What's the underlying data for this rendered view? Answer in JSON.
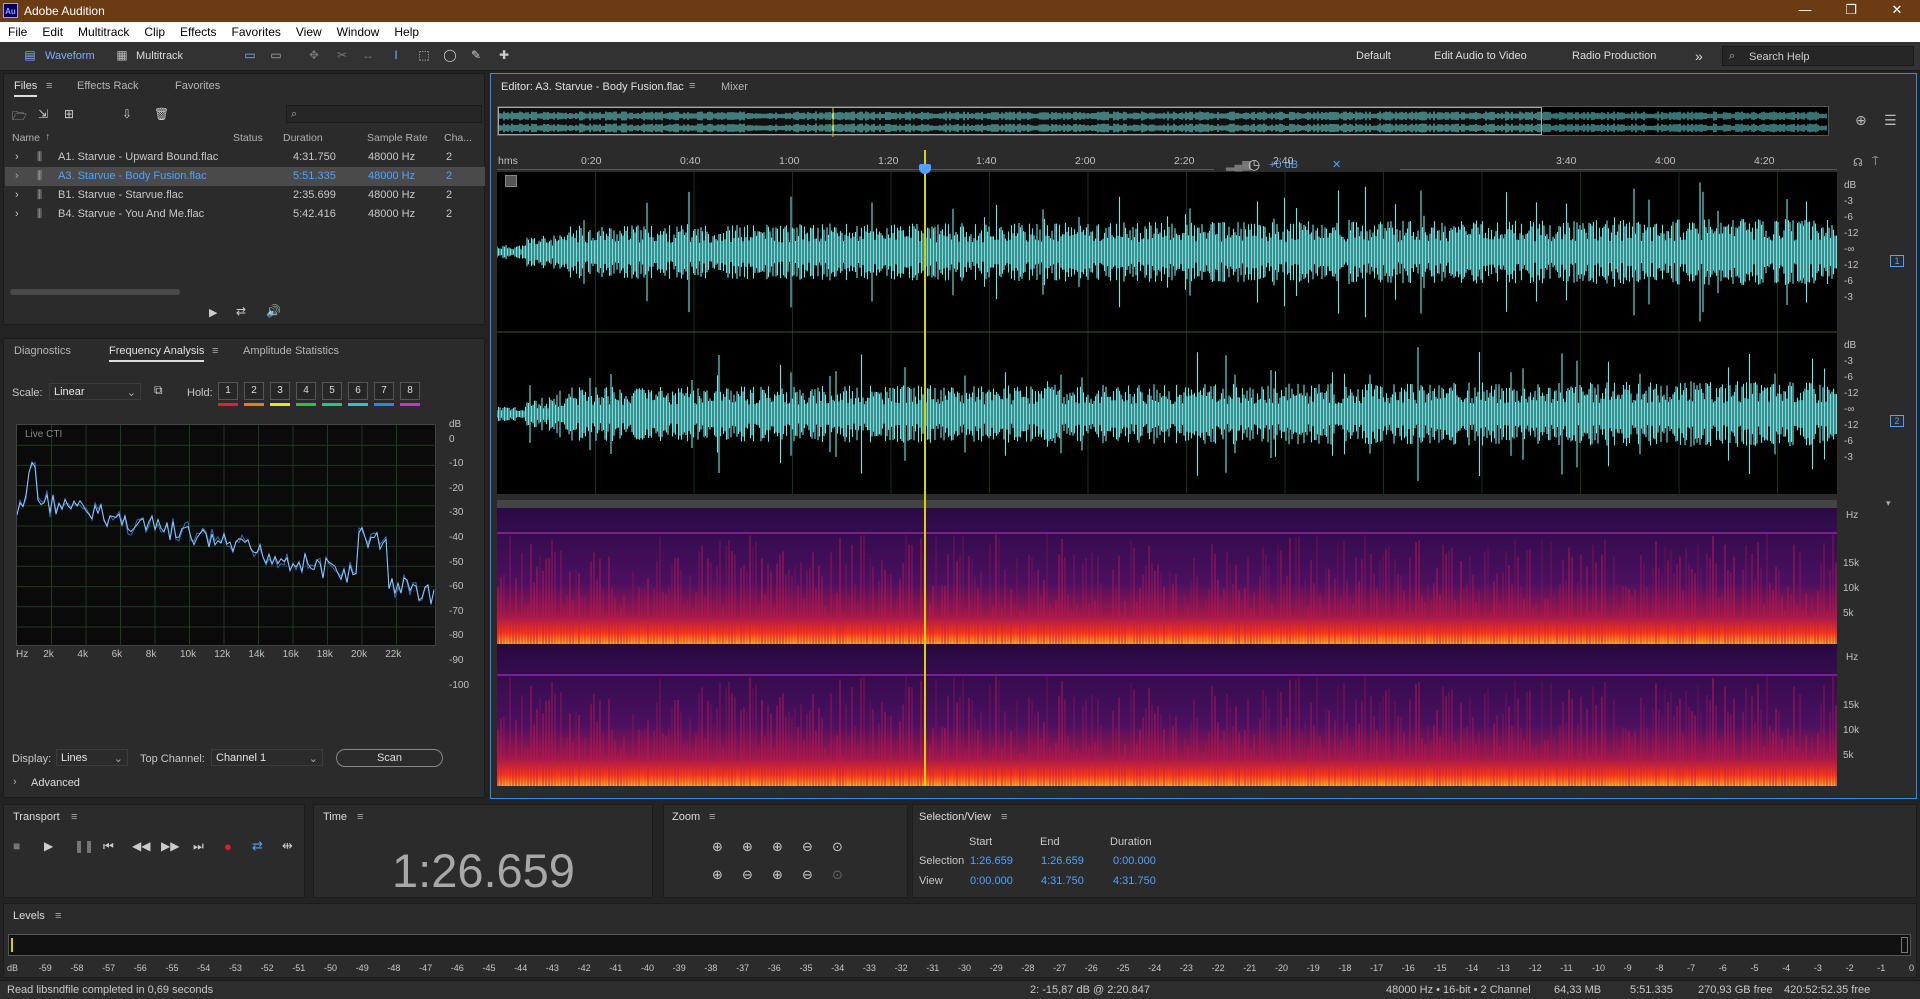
{
  "app": {
    "title": "Adobe Audition",
    "logo": "Au",
    "min_icon": "minimize-icon",
    "max_icon": "maximize-icon",
    "close_icon": "close-icon"
  },
  "menu": [
    "File",
    "Edit",
    "Multitrack",
    "Clip",
    "Effects",
    "Favorites",
    "View",
    "Window",
    "Help"
  ],
  "toolbar": {
    "waveform": "Waveform",
    "multitrack": "Multitrack",
    "workspaces": [
      "Default",
      "Edit Audio to Video",
      "Radio Production"
    ],
    "more": "»",
    "search": "Search Help"
  },
  "files_panel": {
    "tabs": [
      "Files",
      "Effects Rack",
      "Favorites"
    ],
    "search_icon": "⌕",
    "columns": [
      "Name",
      "Status",
      "Duration",
      "Sample Rate",
      "Cha..."
    ],
    "rows": [
      {
        "name": "A1. Starvue - Upward Bound.flac",
        "duration": "4:31.750",
        "rate": "48000 Hz",
        "ch": "2"
      },
      {
        "name": "A3. Starvue - Body Fusion.flac",
        "duration": "5:51.335",
        "rate": "48000 Hz",
        "ch": "2"
      },
      {
        "name": "B1. Starvue - Starvue.flac",
        "duration": "2:35.699",
        "rate": "48000 Hz",
        "ch": "2"
      },
      {
        "name": "B4. Starvue - You And Me.flac",
        "duration": "5:42.416",
        "rate": "48000 Hz",
        "ch": "2"
      }
    ]
  },
  "analysis": {
    "tabs": [
      "Diagnostics",
      "Frequency Analysis",
      "Amplitude Statistics"
    ],
    "scale_label": "Scale:",
    "scale": "Linear",
    "hold_label": "Hold:",
    "holds": [
      "1",
      "2",
      "3",
      "4",
      "5",
      "6",
      "7",
      "8"
    ],
    "hold_colors": [
      "#e0242c",
      "#f07820",
      "#f0e020",
      "#30c040",
      "#30c080",
      "#30c0d0",
      "#3080f0",
      "#d030c0"
    ],
    "live": "Live CTI",
    "db_ticks": [
      "dB",
      "0",
      "-10",
      "-20",
      "-30",
      "-40",
      "-50",
      "-60",
      "-70",
      "-80",
      "-90",
      "-100"
    ],
    "hz_ticks": [
      "Hz",
      "2k",
      "4k",
      "6k",
      "8k",
      "10k",
      "12k",
      "14k",
      "16k",
      "18k",
      "20k",
      "22k"
    ],
    "display_label": "Display:",
    "display": "Lines",
    "top_channel_label": "Top Channel:",
    "top_channel": "Channel 1",
    "scan": "Scan",
    "advanced": "Advanced"
  },
  "editor": {
    "tab": "Editor: A3. Starvue - Body Fusion.flac",
    "mixer": "Mixer",
    "ruler": [
      "hms",
      "0:20",
      "0:40",
      "1:00",
      "1:20",
      "1:40",
      "2:00",
      "2:20",
      "2:40",
      "3:40",
      "4:00",
      "4:20"
    ],
    "hud": "+0 dB",
    "db_scale": [
      "dB",
      "-3",
      "-6",
      "-12",
      "-∞",
      "-12",
      "-6",
      "-3"
    ],
    "ch1": "1",
    "ch2": "2",
    "hz_scale": [
      "Hz",
      "15k",
      "10k",
      "5k"
    ],
    "waveform_color": "#6de7e6"
  },
  "transport": {
    "label": "Transport"
  },
  "time": {
    "label": "Time",
    "value": "1:26.659"
  },
  "zoom": {
    "label": "Zoom"
  },
  "selection": {
    "label": "Selection/View",
    "headers": [
      "Start",
      "End",
      "Duration"
    ],
    "selection_row": {
      "label": "Selection",
      "start": "1:26.659",
      "end": "1:26.659",
      "duration": "0:00.000"
    },
    "view_row": {
      "label": "View",
      "start": "0:00.000",
      "end": "4:31.750",
      "duration": "4:31.750"
    }
  },
  "levels": {
    "label": "Levels",
    "ticks": [
      "dB",
      "-59",
      "-58",
      "-57",
      "-56",
      "-55",
      "-54",
      "-53",
      "-52",
      "-51",
      "-50",
      "-49",
      "-48",
      "-47",
      "-46",
      "-45",
      "-44",
      "-43",
      "-42",
      "-41",
      "-40",
      "-39",
      "-38",
      "-37",
      "-36",
      "-35",
      "-34",
      "-33",
      "-32",
      "-31",
      "-30",
      "-29",
      "-28",
      "-27",
      "-26",
      "-25",
      "-24",
      "-23",
      "-22",
      "-21",
      "-20",
      "-19",
      "-18",
      "-17",
      "-16",
      "-15",
      "-14",
      "-13",
      "-12",
      "-11",
      "-10",
      "-9",
      "-8",
      "-7",
      "-6",
      "-5",
      "-4",
      "-3",
      "-2",
      "-1",
      "0"
    ]
  },
  "status": {
    "left": "Read libsndfile completed in 0,69 seconds",
    "cursor": "2: -15,87 dB @ 2:20.847",
    "format": "48000 Hz • 16-bit • 2 Channel",
    "size": "64,33 MB",
    "duration": "5:51.335",
    "free": "270,93 GB free",
    "free_time": "420:52:52.35 free"
  }
}
